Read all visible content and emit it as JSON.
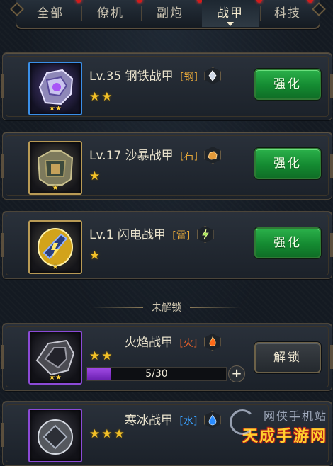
{
  "tabs": [
    {
      "label": "全部",
      "active": false
    },
    {
      "label": "僚机",
      "active": false
    },
    {
      "label": "副炮",
      "active": false
    },
    {
      "label": "战甲",
      "active": true
    },
    {
      "label": "科技",
      "active": false
    }
  ],
  "armors": [
    {
      "level": "Lv.35",
      "name": "钢铁战甲",
      "element": "[钢]",
      "element_icon": "diamond-crystal-icon",
      "stars": "★★",
      "thumb_stars": "★★",
      "button": "强化"
    },
    {
      "level": "Lv.17",
      "name": "沙暴战甲",
      "element": "[石]",
      "element_icon": "rock-icon",
      "stars": "★",
      "thumb_stars": "★",
      "button": "强化"
    },
    {
      "level": "Lv.1",
      "name": "闪电战甲",
      "element": "[雷]",
      "element_icon": "lightning-icon",
      "stars": "★",
      "thumb_stars": "★",
      "button": "强化"
    }
  ],
  "locked_divider": "未解锁",
  "locked_armors": [
    {
      "name": "火焰战甲",
      "element": "[火]",
      "element_icon": "flame-icon",
      "stars": "★★",
      "thumb_stars": "★★",
      "button": "解锁",
      "progress": {
        "text": "5/30",
        "fraction": 0.1667
      }
    },
    {
      "name": "寒冰战甲",
      "element": "[水]",
      "element_icon": "water-drop-icon",
      "stars": "★★★",
      "thumb_stars": ""
    }
  ],
  "watermark": {
    "line1": "网侠手机站",
    "line2": "天成手游网"
  },
  "colors": {
    "button_green": "#148a31",
    "star_gold": "#f3c128",
    "element_orange": "#e4a73a",
    "progress_purple": "#a24be6",
    "tab_dot_red": "#d21b1b"
  }
}
